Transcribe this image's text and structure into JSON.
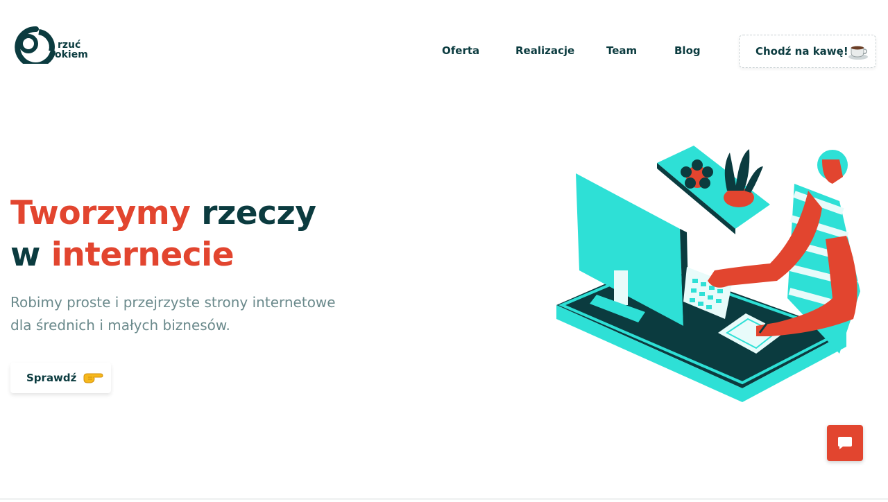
{
  "brand": {
    "line1": "rzuć",
    "line2": "okiem"
  },
  "nav": {
    "items": [
      "Oferta",
      "Realizacje",
      "Team",
      "Blog"
    ],
    "cta_label": "Chodź na kawę!",
    "cta_icon": "coffee-cup-icon"
  },
  "hero": {
    "title_part1": "Tworzymy",
    "title_part2": "rzeczy",
    "title_part3": "w",
    "title_part4": "internecie",
    "subtitle_line1": "Robimy proste i przejrzyste strony internetowe",
    "subtitle_line2": "dla średnich i małych biznesów.",
    "button_label": "Sprawdź",
    "button_icon": "pointing-hand-icon"
  },
  "chat": {
    "icon": "chat-bubble-icon"
  },
  "colors": {
    "accent": "#e2452f",
    "dark": "#0b3b3f",
    "teal": "#2ee0d6",
    "muted": "#6b8a8c"
  }
}
